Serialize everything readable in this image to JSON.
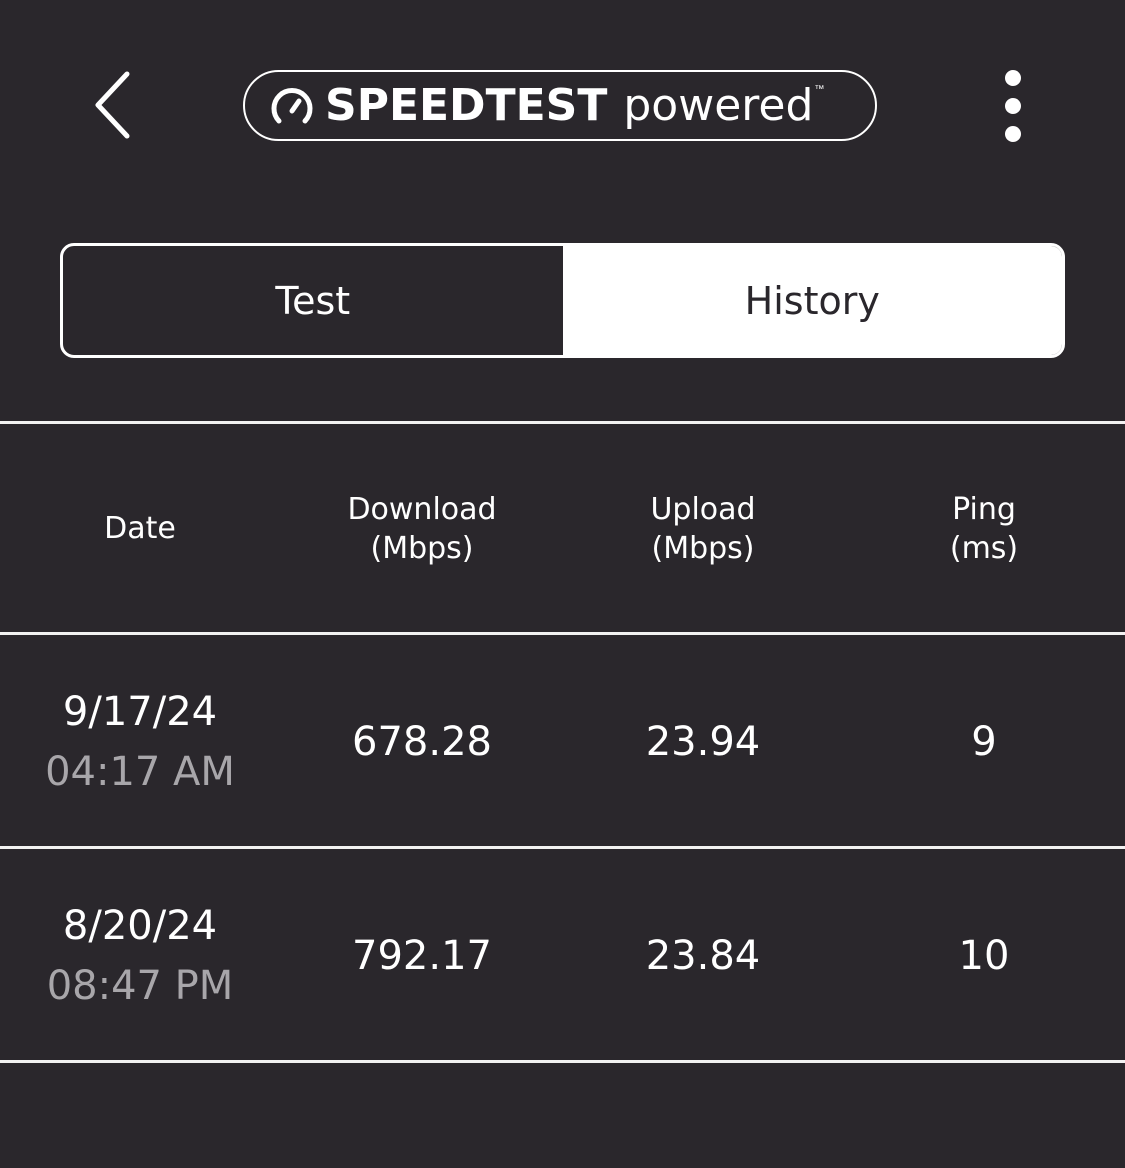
{
  "header": {
    "back_icon": "chevron-left-icon",
    "brand_icon": "speedometer-gauge-icon",
    "brand_strong": "SPEEDTEST",
    "brand_light": "powered",
    "brand_tm": "™",
    "more_icon": "vertical-ellipsis-icon"
  },
  "tabs": [
    {
      "label": "Test",
      "active": false
    },
    {
      "label": "History",
      "active": true
    }
  ],
  "table": {
    "columns": [
      {
        "line1": "Date",
        "line2": ""
      },
      {
        "line1": "Download",
        "line2": "(Mbps)"
      },
      {
        "line1": "Upload",
        "line2": "(Mbps)"
      },
      {
        "line1": "Ping",
        "line2": "(ms)"
      }
    ],
    "rows": [
      {
        "date": "9/17/24",
        "time": "04:17 AM",
        "download": "678.28",
        "upload": "23.94",
        "ping": "9"
      },
      {
        "date": "8/20/24",
        "time": "08:47 PM",
        "download": "792.17",
        "upload": "23.84",
        "ping": "10"
      }
    ]
  },
  "colors": {
    "background": "#2a272c",
    "foreground": "#ffffff",
    "muted_text": "#a8a6aa"
  }
}
